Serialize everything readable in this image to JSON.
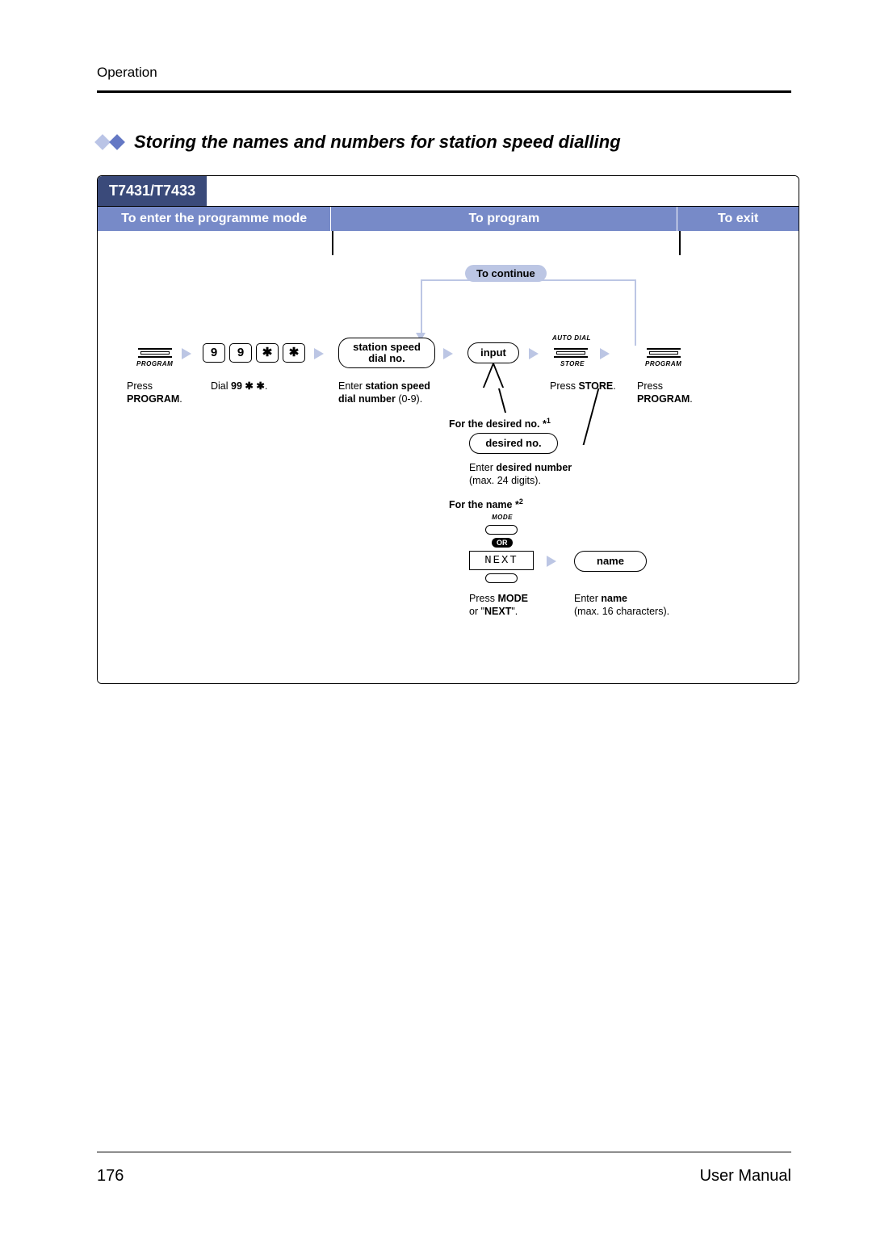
{
  "page": {
    "section": "Operation",
    "title": "Storing the names and numbers for station speed dialling",
    "model_tab": "T7431/T7433",
    "col1": "To enter the programme mode",
    "col2": "To program",
    "col3": "To exit",
    "continue_pill": "To continue",
    "keys": {
      "k1": "9",
      "k2": "9",
      "k3": "✱",
      "k4": "✱"
    },
    "program_btn": "PROGRAM",
    "autodial_top": "AUTO DIAL",
    "autodial_bot": "STORE",
    "station_speed_oval": "station speed\ndial no.",
    "input_oval": "input",
    "desired_oval": "desired no.",
    "name_oval": "name",
    "next_display": "NEXT",
    "mode_label": "MODE",
    "or_label": "OR",
    "cap_press_program": "Press",
    "cap_press_program_b": "PROGRAM",
    "cap_dial": "Dial 99 ✱ ✱.",
    "cap_enter_ssd1": "Enter station speed",
    "cap_enter_ssd2": "dial number (0-9).",
    "cap_press_store": "Press STORE.",
    "cap_for_desired": "For the desired no. *1",
    "cap_enter_desired1": "Enter desired number",
    "cap_enter_desired2": "(max. 24 digits).",
    "cap_for_name": "For the name *2",
    "cap_press_mode1": "Press MODE",
    "cap_press_mode2": "or \"NEXT\".",
    "cap_enter_name1": "Enter name",
    "cap_enter_name2": "(max. 16 characters)."
  },
  "footer": {
    "page_no": "176",
    "doc": "User Manual"
  }
}
